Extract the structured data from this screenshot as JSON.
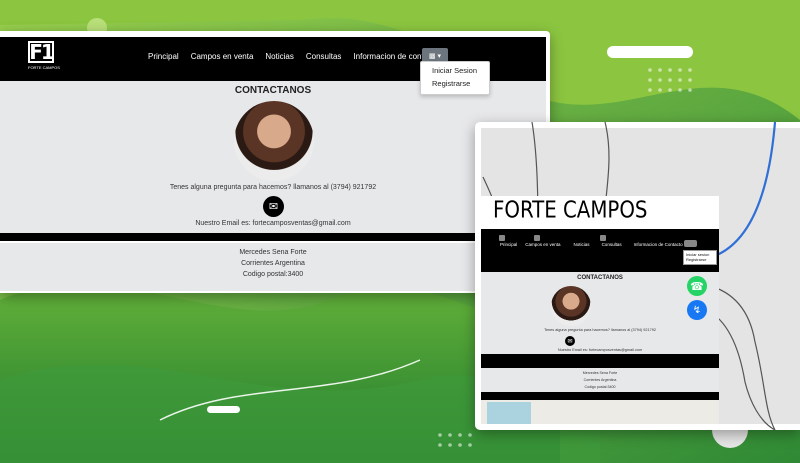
{
  "main_window": {
    "logo": {
      "mark": "F1",
      "subtitle": "FORTE CAMPOS"
    },
    "nav": {
      "items": [
        "Principal",
        "Campos en venta",
        "Noticias",
        "Consultas",
        "Informacion de contacto"
      ],
      "user_icon": "user-icon",
      "dropdown": [
        "Iniciar Sesion",
        "Registrarse"
      ]
    },
    "contact": {
      "heading": "CONTACTANOS",
      "question": "Tenes alguna pregunta para hacemos? llamanos al (3794) 921792",
      "email_icon": "envelope-icon",
      "email_text": "Nuestro Email es: fortecamposventas@gmail.com"
    },
    "footer": {
      "name": "Mercedes Sena Forte",
      "location": "Corrientes Argentina",
      "postal": "Codigo postal:3400"
    }
  },
  "preview_window": {
    "brand_title": "FORTE CAMPOS",
    "nav": {
      "items": [
        "Principal",
        "Campos en venta",
        "Noticias",
        "Consultas",
        "Informacion de Contacto"
      ],
      "dropdown": [
        "Iniciar sesion",
        "Registrarse"
      ]
    },
    "contact": {
      "heading": "CONTACTANOS",
      "question": "Tenes alguna pregunta para hacemos? llamanos al (3794) 921792",
      "email_text": "Nuestro Email es: fortecamposventas@gmail.com"
    },
    "footer": {
      "name": "Mercedes Sena Forte",
      "location": "Corrientes Argentina",
      "postal": "Codigo postal:3400"
    },
    "social_icons": [
      "whatsapp-icon",
      "messenger-icon"
    ]
  },
  "colors": {
    "navbar": "#000000",
    "content_bg": "#e7e8ea",
    "background_green": "#6fb536",
    "connector_blue": "#2f6fd6"
  }
}
